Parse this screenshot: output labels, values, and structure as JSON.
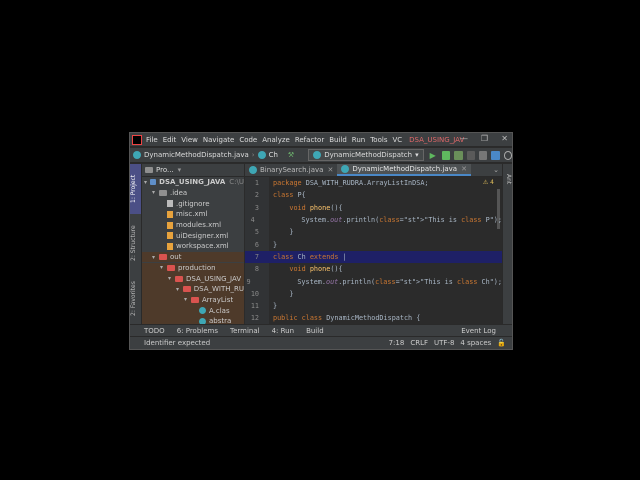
{
  "menu": [
    "File",
    "Edit",
    "View",
    "Navigate",
    "Code",
    "Analyze",
    "Refactor",
    "Build",
    "Run",
    "Tools",
    "VC"
  ],
  "project_name": "DSA_USING_JAV",
  "nav": {
    "file": "DynamicMethodDispatch.java",
    "cls": "Ch",
    "run_config": "DynamicMethodDispatch"
  },
  "left_tabs": [
    "1: Project",
    "2: Structure",
    "2: Favorites"
  ],
  "right_tab": "Ant",
  "project_panel": {
    "header": "Pro..."
  },
  "tree": [
    {
      "label": "DSA_USING_JAVA",
      "extra": "C:\\U",
      "level": 0,
      "type": "folder",
      "open": true
    },
    {
      "label": ".idea",
      "level": 1,
      "type": "folder",
      "open": true
    },
    {
      "label": ".gitignore",
      "level": 2,
      "type": "file"
    },
    {
      "label": "misc.xml",
      "level": 2,
      "type": "xml"
    },
    {
      "label": "modules.xml",
      "level": 2,
      "type": "xml"
    },
    {
      "label": "uiDesigner.xml",
      "level": 2,
      "type": "xml"
    },
    {
      "label": "workspace.xml",
      "level": 2,
      "type": "xml"
    },
    {
      "label": "out",
      "level": 1,
      "type": "red",
      "open": true
    },
    {
      "label": "production",
      "level": 2,
      "type": "red",
      "open": true
    },
    {
      "label": "DSA_USING_JAV",
      "level": 3,
      "type": "red",
      "open": true
    },
    {
      "label": "DSA_WITH_RU",
      "level": 4,
      "type": "red",
      "open": true
    },
    {
      "label": "ArrayList",
      "level": 5,
      "type": "red",
      "open": true
    },
    {
      "label": "A.clas",
      "level": 6,
      "type": "cls"
    },
    {
      "label": "abstra",
      "level": 6,
      "type": "cls"
    }
  ],
  "tabs": [
    {
      "label": "BinarySearch.java",
      "active": false
    },
    {
      "label": "DynamicMethodDispatch.java",
      "active": true
    }
  ],
  "code_lines": [
    {
      "n": "1",
      "text": "package DSA_WITH_RUDRA.ArrayListInDSA;"
    },
    {
      "n": "2",
      "text": "class P{"
    },
    {
      "n": "3",
      "text": "    void phone(){"
    },
    {
      "n": "4",
      "text": "        System.out.println(\"This is class P\");"
    },
    {
      "n": "5",
      "text": "    }"
    },
    {
      "n": "6",
      "text": "}"
    },
    {
      "n": "7",
      "text": "class Ch extends |"
    },
    {
      "n": "8",
      "text": "    void phone(){"
    },
    {
      "n": "9",
      "text": "        System.out.println(\"This is class Ch\");"
    },
    {
      "n": "10",
      "text": "    }"
    },
    {
      "n": "11",
      "text": "}"
    },
    {
      "n": "12",
      "text": "public class DynamicMethodDispatch {"
    }
  ],
  "warning_count": "4",
  "bottom_tools": [
    "TODO",
    "6: Problems",
    "Terminal",
    "4: Run",
    "Build",
    "Event Log"
  ],
  "status": {
    "message": "Identifier expected",
    "position": "7:18",
    "line_sep": "CRLF",
    "encoding": "UTF-8",
    "indent": "4 spaces"
  },
  "colors": {
    "accent": "#4a88c7",
    "error_folder": "#d9534f",
    "highlight": "#1e2066"
  }
}
